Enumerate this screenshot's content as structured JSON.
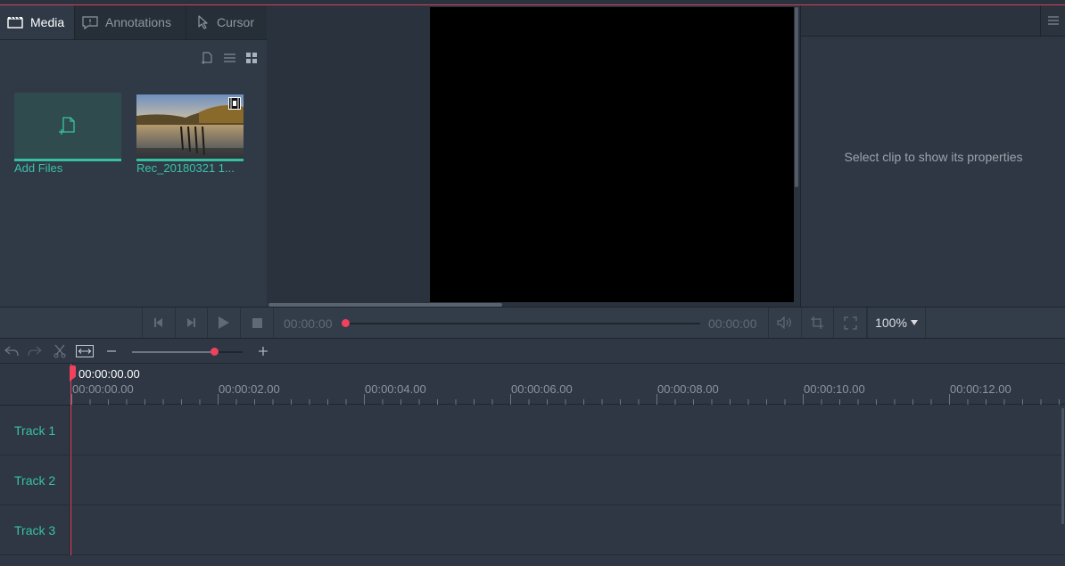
{
  "tabs": [
    {
      "label": "Media",
      "icon": "clapperboard-icon",
      "active": true
    },
    {
      "label": "Annotations",
      "icon": "annotation-icon",
      "active": false
    },
    {
      "label": "Cursor",
      "icon": "cursor-icon",
      "active": false
    }
  ],
  "media": {
    "add_files_label": "Add Files",
    "clip_label": "Rec_20180321 1..."
  },
  "properties": {
    "placeholder": "Select clip to show its properties"
  },
  "playback": {
    "current_time": "00:00:00",
    "total_time": "00:00:00",
    "zoom": "100%",
    "progress": 0
  },
  "timeline": {
    "current_timecode": "00:00:00.00",
    "ruler": [
      "00:00:00.00",
      "00:00:02.00",
      "00:00:04.00",
      "00:00:06.00",
      "00:00:08.00",
      "00:00:10.00",
      "00:00:12.00"
    ],
    "zoom_level": 0.74,
    "tracks": [
      "Track 1",
      "Track 2",
      "Track 3"
    ]
  },
  "colors": {
    "accent": "#39c2a6",
    "playhead": "#f0415e"
  }
}
